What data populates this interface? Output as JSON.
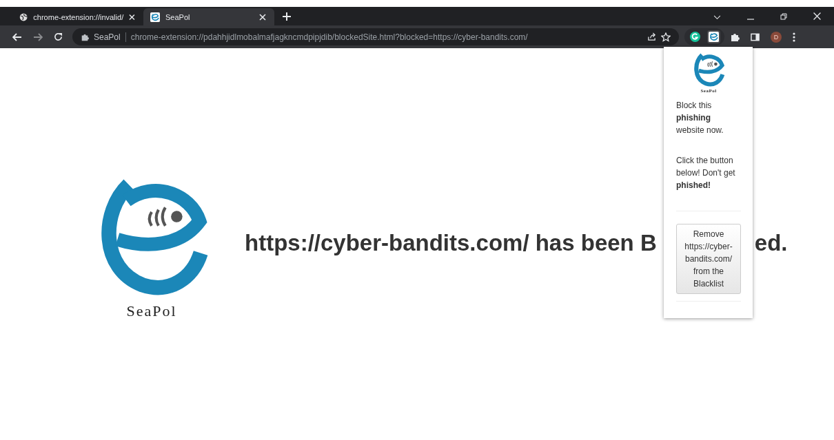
{
  "tabs": [
    {
      "title": "chrome-extension://invalid/",
      "selected": false
    },
    {
      "title": "SeaPol",
      "selected": true
    }
  ],
  "address_bar": {
    "site_label": "SeaPol",
    "url": "chrome-extension://pdahhjidlmobalmafjagkncmdpipjdib/blockedSite.html?blocked=https://cyber-bandits.com/"
  },
  "profile": {
    "initial": "D"
  },
  "page": {
    "logo_text": "SeaPol",
    "message_parts": [
      "https://cyber-bandits.com/ has been B",
      "ed."
    ]
  },
  "popup": {
    "logo_text": "SeaPol",
    "paragraphs": [
      "Block this **phishing** website now.",
      "Click the button below! Don't get **phished!**"
    ],
    "button": "Remove https://cyber-bandits.com/ from the Blacklist"
  }
}
